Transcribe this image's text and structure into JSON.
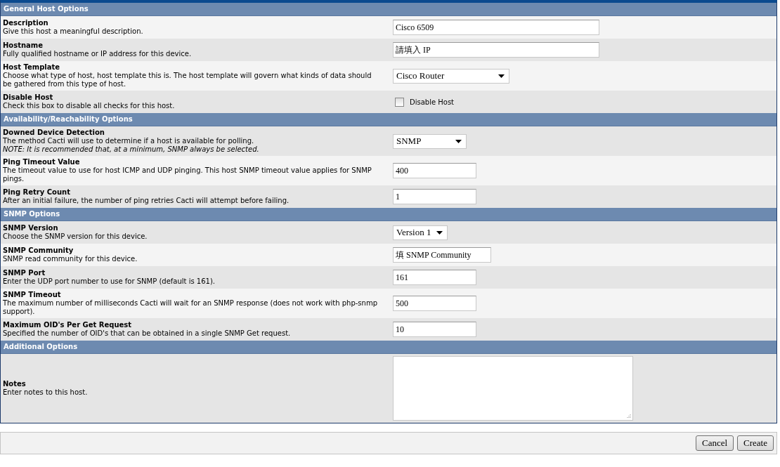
{
  "sections": [
    {
      "title": "General Host Options",
      "rows": [
        {
          "label": "Description",
          "description": "Give this host a meaningful description.",
          "control": {
            "kind": "text",
            "value": "Cisco 6509"
          }
        },
        {
          "label": "Hostname",
          "description": "Fully qualified hostname or IP address for this device.",
          "control": {
            "kind": "text",
            "value": "請填入 IP"
          }
        },
        {
          "label": "Host Template",
          "description": "Choose what type of host, host template this is. The host template will govern what kinds of data should be gathered from this type of host.",
          "control": {
            "kind": "select",
            "value": "Cisco Router"
          }
        },
        {
          "label": "Disable Host",
          "description": "Check this box to disable all checks for this host.",
          "control": {
            "kind": "checkbox",
            "label": "Disable Host",
            "checked": false
          }
        }
      ]
    },
    {
      "title": "Availability/Reachability Options",
      "rows": [
        {
          "label": "Downed Device Detection",
          "description": "The method Cacti will use to determine if a host is available for polling.",
          "note": "NOTE: It is recommended that, at a minimum, SNMP always be selected.",
          "control": {
            "kind": "select",
            "value": "SNMP"
          }
        },
        {
          "label": "Ping Timeout Value",
          "description": "The timeout value to use for host ICMP and UDP pinging. This host SNMP timeout value applies for SNMP pings.",
          "control": {
            "kind": "text",
            "value": "400"
          }
        },
        {
          "label": "Ping Retry Count",
          "description": "After an initial failure, the number of ping retries Cacti will attempt before failing.",
          "control": {
            "kind": "text",
            "value": "1"
          }
        }
      ]
    },
    {
      "title": "SNMP Options",
      "rows": [
        {
          "label": "SNMP Version",
          "description": "Choose the SNMP version for this device.",
          "control": {
            "kind": "select",
            "value": "Version 1"
          }
        },
        {
          "label": "SNMP Community",
          "description": "SNMP read community for this device.",
          "control": {
            "kind": "text",
            "value": "填 SNMP Community"
          }
        },
        {
          "label": "SNMP Port",
          "description": "Enter the UDP port number to use for SNMP (default is 161).",
          "control": {
            "kind": "text",
            "value": "161"
          }
        },
        {
          "label": "SNMP Timeout",
          "description": "The maximum number of milliseconds Cacti will wait for an SNMP response (does not work with php-snmp support).",
          "control": {
            "kind": "text",
            "value": "500"
          }
        },
        {
          "label": "Maximum OID's Per Get Request",
          "description": "Specified the number of OID's that can be obtained in a single SNMP Get request.",
          "control": {
            "kind": "text",
            "value": "10"
          }
        }
      ]
    },
    {
      "title": "Additional Options",
      "rows": [
        {
          "label": "Notes",
          "description": "Enter notes to this host.",
          "control": {
            "kind": "textarea"
          }
        }
      ]
    }
  ],
  "buttons": [
    "Cancel",
    "Create"
  ]
}
